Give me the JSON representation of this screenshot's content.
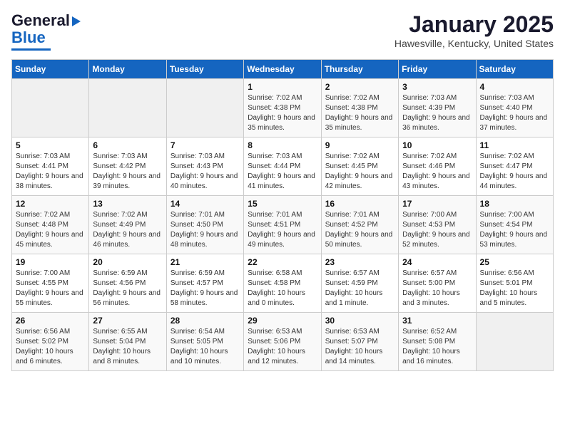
{
  "header": {
    "logo_line1": "General",
    "logo_line2": "Blue",
    "title": "January 2025",
    "subtitle": "Hawesville, Kentucky, United States"
  },
  "days_of_week": [
    "Sunday",
    "Monday",
    "Tuesday",
    "Wednesday",
    "Thursday",
    "Friday",
    "Saturday"
  ],
  "weeks": [
    [
      {
        "num": "",
        "detail": ""
      },
      {
        "num": "",
        "detail": ""
      },
      {
        "num": "",
        "detail": ""
      },
      {
        "num": "1",
        "detail": "Sunrise: 7:02 AM\nSunset: 4:38 PM\nDaylight: 9 hours and 35 minutes."
      },
      {
        "num": "2",
        "detail": "Sunrise: 7:02 AM\nSunset: 4:38 PM\nDaylight: 9 hours and 35 minutes."
      },
      {
        "num": "3",
        "detail": "Sunrise: 7:03 AM\nSunset: 4:39 PM\nDaylight: 9 hours and 36 minutes."
      },
      {
        "num": "4",
        "detail": "Sunrise: 7:03 AM\nSunset: 4:40 PM\nDaylight: 9 hours and 37 minutes."
      }
    ],
    [
      {
        "num": "5",
        "detail": "Sunrise: 7:03 AM\nSunset: 4:41 PM\nDaylight: 9 hours and 38 minutes."
      },
      {
        "num": "6",
        "detail": "Sunrise: 7:03 AM\nSunset: 4:42 PM\nDaylight: 9 hours and 39 minutes."
      },
      {
        "num": "7",
        "detail": "Sunrise: 7:03 AM\nSunset: 4:43 PM\nDaylight: 9 hours and 40 minutes."
      },
      {
        "num": "8",
        "detail": "Sunrise: 7:03 AM\nSunset: 4:44 PM\nDaylight: 9 hours and 41 minutes."
      },
      {
        "num": "9",
        "detail": "Sunrise: 7:02 AM\nSunset: 4:45 PM\nDaylight: 9 hours and 42 minutes."
      },
      {
        "num": "10",
        "detail": "Sunrise: 7:02 AM\nSunset: 4:46 PM\nDaylight: 9 hours and 43 minutes."
      },
      {
        "num": "11",
        "detail": "Sunrise: 7:02 AM\nSunset: 4:47 PM\nDaylight: 9 hours and 44 minutes."
      }
    ],
    [
      {
        "num": "12",
        "detail": "Sunrise: 7:02 AM\nSunset: 4:48 PM\nDaylight: 9 hours and 45 minutes."
      },
      {
        "num": "13",
        "detail": "Sunrise: 7:02 AM\nSunset: 4:49 PM\nDaylight: 9 hours and 46 minutes."
      },
      {
        "num": "14",
        "detail": "Sunrise: 7:01 AM\nSunset: 4:50 PM\nDaylight: 9 hours and 48 minutes."
      },
      {
        "num": "15",
        "detail": "Sunrise: 7:01 AM\nSunset: 4:51 PM\nDaylight: 9 hours and 49 minutes."
      },
      {
        "num": "16",
        "detail": "Sunrise: 7:01 AM\nSunset: 4:52 PM\nDaylight: 9 hours and 50 minutes."
      },
      {
        "num": "17",
        "detail": "Sunrise: 7:00 AM\nSunset: 4:53 PM\nDaylight: 9 hours and 52 minutes."
      },
      {
        "num": "18",
        "detail": "Sunrise: 7:00 AM\nSunset: 4:54 PM\nDaylight: 9 hours and 53 minutes."
      }
    ],
    [
      {
        "num": "19",
        "detail": "Sunrise: 7:00 AM\nSunset: 4:55 PM\nDaylight: 9 hours and 55 minutes."
      },
      {
        "num": "20",
        "detail": "Sunrise: 6:59 AM\nSunset: 4:56 PM\nDaylight: 9 hours and 56 minutes."
      },
      {
        "num": "21",
        "detail": "Sunrise: 6:59 AM\nSunset: 4:57 PM\nDaylight: 9 hours and 58 minutes."
      },
      {
        "num": "22",
        "detail": "Sunrise: 6:58 AM\nSunset: 4:58 PM\nDaylight: 10 hours and 0 minutes."
      },
      {
        "num": "23",
        "detail": "Sunrise: 6:57 AM\nSunset: 4:59 PM\nDaylight: 10 hours and 1 minute."
      },
      {
        "num": "24",
        "detail": "Sunrise: 6:57 AM\nSunset: 5:00 PM\nDaylight: 10 hours and 3 minutes."
      },
      {
        "num": "25",
        "detail": "Sunrise: 6:56 AM\nSunset: 5:01 PM\nDaylight: 10 hours and 5 minutes."
      }
    ],
    [
      {
        "num": "26",
        "detail": "Sunrise: 6:56 AM\nSunset: 5:02 PM\nDaylight: 10 hours and 6 minutes."
      },
      {
        "num": "27",
        "detail": "Sunrise: 6:55 AM\nSunset: 5:04 PM\nDaylight: 10 hours and 8 minutes."
      },
      {
        "num": "28",
        "detail": "Sunrise: 6:54 AM\nSunset: 5:05 PM\nDaylight: 10 hours and 10 minutes."
      },
      {
        "num": "29",
        "detail": "Sunrise: 6:53 AM\nSunset: 5:06 PM\nDaylight: 10 hours and 12 minutes."
      },
      {
        "num": "30",
        "detail": "Sunrise: 6:53 AM\nSunset: 5:07 PM\nDaylight: 10 hours and 14 minutes."
      },
      {
        "num": "31",
        "detail": "Sunrise: 6:52 AM\nSunset: 5:08 PM\nDaylight: 10 hours and 16 minutes."
      },
      {
        "num": "",
        "detail": ""
      }
    ]
  ]
}
